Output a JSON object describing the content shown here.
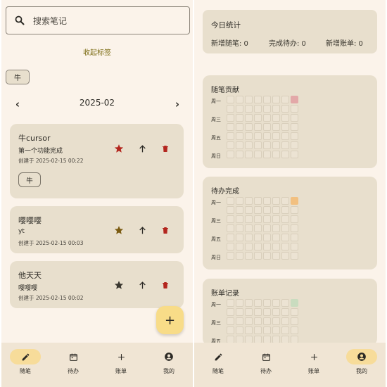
{
  "left": {
    "search": {
      "placeholder": "搜索笔记",
      "icon": "search-icon"
    },
    "collapse_label": "收起标签",
    "filter_tag": "牛",
    "month": {
      "label": "2025-02",
      "prev": "‹",
      "next": "›"
    },
    "notes": [
      {
        "title": "牛cursor",
        "body": "第一个功能完成",
        "created": "创建于 2025-02-15 00:22",
        "tag": "牛",
        "star_color": "#b3261e"
      },
      {
        "title": "嘤嘤嘤",
        "body": "yt",
        "created": "创建于 2025-02-15 00:03",
        "tag": "",
        "star_color": "#7a5a10"
      },
      {
        "title": "他天天",
        "body": "嘤嘤嘤",
        "created": "创建于 2025-02-15 00:02",
        "tag": "",
        "star_color": "#3a372f"
      }
    ],
    "fab": "+",
    "nav": [
      {
        "label": "随笔",
        "icon": "pencil-icon",
        "active": true
      },
      {
        "label": "待办",
        "icon": "calendar-icon",
        "active": false
      },
      {
        "label": "账单",
        "icon": "plus-icon",
        "active": false
      },
      {
        "label": "我的",
        "icon": "account-icon",
        "active": false
      }
    ]
  },
  "right": {
    "today": {
      "title": "今日统计",
      "new_notes": "新增随笔: 0",
      "done_todos": "完成待办: 0",
      "new_bills": "新增账单: 0"
    },
    "sections": [
      {
        "title": "随笔贡献",
        "days": [
          "周一",
          "周三",
          "周五",
          "周日"
        ],
        "highlight_color": "#e3a8a8"
      },
      {
        "title": "待办完成",
        "days": [
          "周一",
          "周三",
          "周五",
          "周日"
        ],
        "highlight_color": "#f2c080"
      },
      {
        "title": "账单记录",
        "days": [
          "周一",
          "周三",
          "周五"
        ],
        "highlight_color": "#c9dcbf"
      }
    ],
    "nav": [
      {
        "label": "随笔",
        "icon": "pencil-icon",
        "active": false
      },
      {
        "label": "待办",
        "icon": "calendar-icon",
        "active": false
      },
      {
        "label": "账单",
        "icon": "plus-icon",
        "active": false
      },
      {
        "label": "我的",
        "icon": "account-icon",
        "active": true
      }
    ]
  }
}
